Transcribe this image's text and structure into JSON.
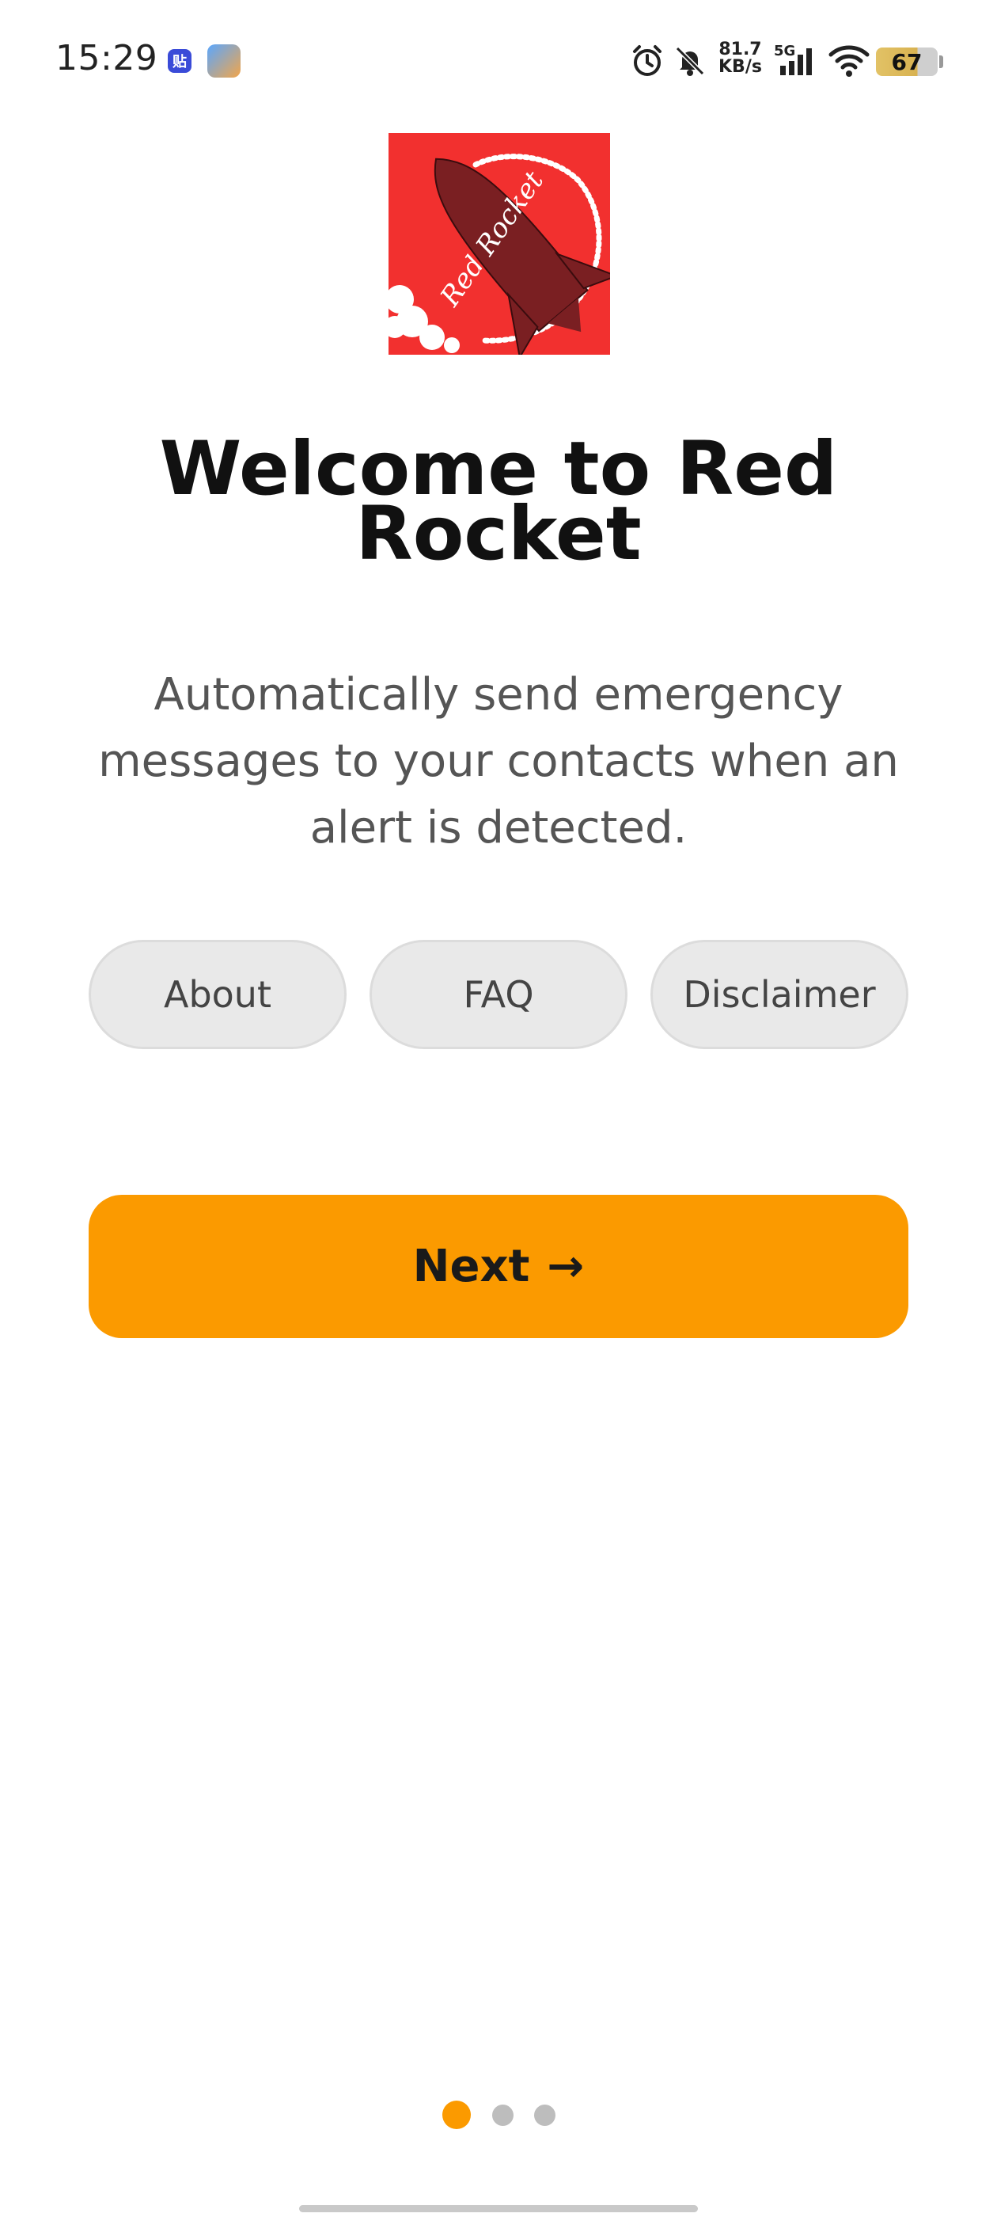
{
  "status_bar": {
    "time": "15:29",
    "app1_glyph": "贴",
    "network_speed_value": "81.7",
    "network_speed_unit": "KB/s",
    "network_type": "5G",
    "battery_level": "67"
  },
  "logo": {
    "text": "Red Rocket"
  },
  "welcome": {
    "title": "Welcome to Red Rocket",
    "subtitle": "Automatically send emergency messages to your contacts when an alert is detected."
  },
  "links": {
    "about": "About",
    "faq": "FAQ",
    "disclaimer": "Disclaimer"
  },
  "next_button": {
    "label": "Next",
    "arrow": "→"
  },
  "pager": {
    "total": 3,
    "active_index": 0
  },
  "colors": {
    "accent": "#fb9a00",
    "logo_bg": "#f2302f",
    "rocket": "#7a1f22",
    "pill_bg": "#e9e9e9",
    "dot_inactive": "#bdbdbd"
  }
}
